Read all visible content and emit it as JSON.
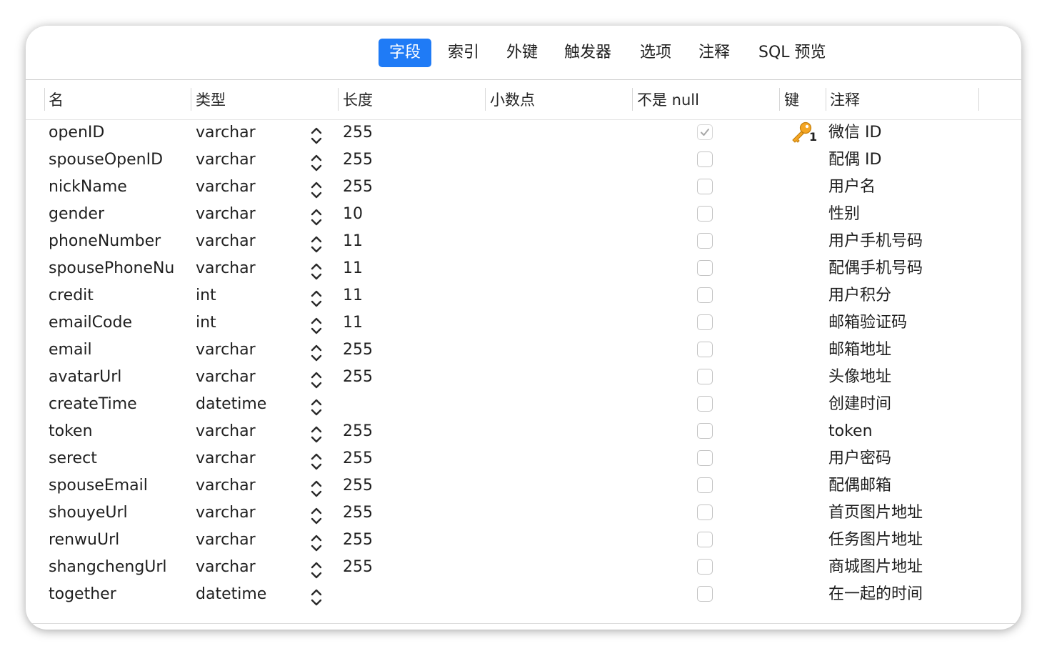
{
  "tabs": [
    {
      "label": "字段",
      "active": true
    },
    {
      "label": "索引",
      "active": false
    },
    {
      "label": "外键",
      "active": false
    },
    {
      "label": "触发器",
      "active": false
    },
    {
      "label": "选项",
      "active": false
    },
    {
      "label": "注释",
      "active": false
    },
    {
      "label": "SQL 预览",
      "active": false
    }
  ],
  "columns": {
    "name": "名",
    "type": "类型",
    "length": "长度",
    "decimals": "小数点",
    "not_null": "不是 null",
    "key": "键",
    "comment": "注释"
  },
  "accent_color": "#1f7bf6",
  "key_icon_color": "#f5a623",
  "rows": [
    {
      "name": "openID",
      "type": "varchar",
      "length": "255",
      "not_null": true,
      "key": "1",
      "comment": "微信 ID"
    },
    {
      "name": "spouseOpenID",
      "type": "varchar",
      "length": "255",
      "not_null": false,
      "key": "",
      "comment": "配偶 ID"
    },
    {
      "name": "nickName",
      "type": "varchar",
      "length": "255",
      "not_null": false,
      "key": "",
      "comment": "用户名"
    },
    {
      "name": "gender",
      "type": "varchar",
      "length": "10",
      "not_null": false,
      "key": "",
      "comment": "性别"
    },
    {
      "name": "phoneNumber",
      "type": "varchar",
      "length": "11",
      "not_null": false,
      "key": "",
      "comment": "用户手机号码"
    },
    {
      "name": "spousePhoneNu",
      "type": "varchar",
      "length": "11",
      "not_null": false,
      "key": "",
      "comment": "配偶手机号码"
    },
    {
      "name": "credit",
      "type": "int",
      "length": "11",
      "not_null": false,
      "key": "",
      "comment": "用户积分"
    },
    {
      "name": "emailCode",
      "type": "int",
      "length": "11",
      "not_null": false,
      "key": "",
      "comment": "邮箱验证码"
    },
    {
      "name": "email",
      "type": "varchar",
      "length": "255",
      "not_null": false,
      "key": "",
      "comment": "邮箱地址"
    },
    {
      "name": "avatarUrl",
      "type": "varchar",
      "length": "255",
      "not_null": false,
      "key": "",
      "comment": "头像地址"
    },
    {
      "name": "createTime",
      "type": "datetime",
      "length": "",
      "not_null": false,
      "key": "",
      "comment": "创建时间"
    },
    {
      "name": "token",
      "type": "varchar",
      "length": "255",
      "not_null": false,
      "key": "",
      "comment": "token"
    },
    {
      "name": "serect",
      "type": "varchar",
      "length": "255",
      "not_null": false,
      "key": "",
      "comment": "用户密码"
    },
    {
      "name": "spouseEmail",
      "type": "varchar",
      "length": "255",
      "not_null": false,
      "key": "",
      "comment": "配偶邮箱"
    },
    {
      "name": "shouyeUrl",
      "type": "varchar",
      "length": "255",
      "not_null": false,
      "key": "",
      "comment": "首页图片地址"
    },
    {
      "name": "renwuUrl",
      "type": "varchar",
      "length": "255",
      "not_null": false,
      "key": "",
      "comment": "任务图片地址"
    },
    {
      "name": "shangchengUrl",
      "type": "varchar",
      "length": "255",
      "not_null": false,
      "key": "",
      "comment": "商城图片地址"
    },
    {
      "name": "together",
      "type": "datetime",
      "length": "",
      "not_null": false,
      "key": "",
      "comment": "在一起的时间"
    }
  ]
}
